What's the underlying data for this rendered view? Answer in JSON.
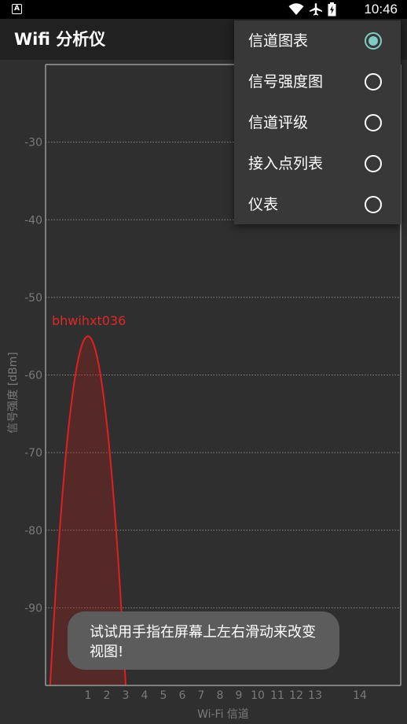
{
  "status_bar": {
    "time": "10:46",
    "icons": [
      "android-app-icon",
      "wifi-icon",
      "airplane-icon",
      "battery-icon"
    ]
  },
  "app_bar": {
    "title": "Wifi 分析仪"
  },
  "menu": {
    "items": [
      {
        "label": "信道图表",
        "selected": true
      },
      {
        "label": "信号强度图",
        "selected": false
      },
      {
        "label": "信道评级",
        "selected": false
      },
      {
        "label": "接入点列表",
        "selected": false
      },
      {
        "label": "仪表",
        "selected": false
      }
    ],
    "accent_color": "#80cbc4"
  },
  "chart_data": {
    "type": "area",
    "xlabel": "Wi-Fi 信道",
    "ylabel": "信号强度 [dBm]",
    "x_ticks": [
      "1",
      "2",
      "3",
      "4",
      "5",
      "6",
      "7",
      "8",
      "9",
      "10",
      "11",
      "12",
      "13",
      "14"
    ],
    "y_ticks": [
      "-30",
      "-40",
      "-50",
      "-60",
      "-70",
      "-80",
      "-90"
    ],
    "ylim": [
      -100,
      -20
    ],
    "grid": true,
    "series": [
      {
        "name": "bhwihxt036",
        "channel": 1,
        "width_channels": [
          -1,
          3
        ],
        "peak_dbm": -55,
        "color": "#e02020"
      }
    ]
  },
  "toast": {
    "text": "试试用手指在屏幕上左右滑动来改变视图!"
  }
}
